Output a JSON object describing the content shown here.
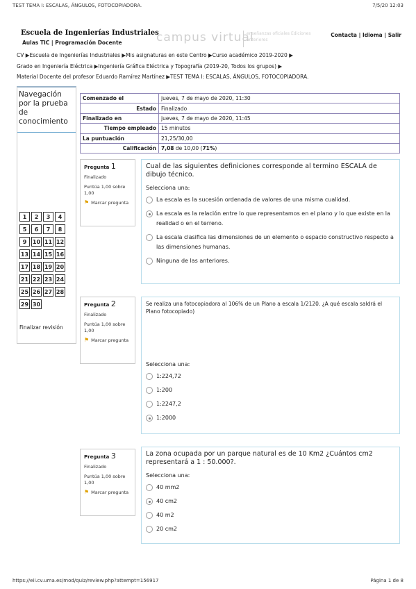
{
  "print": {
    "header_left": "TEST TEMA I: ESCALAS, ÁNGULOS, FOTOCOPIADORA.",
    "header_right": "7/5/20 12:03",
    "footer_left": "https://eii.cv.uma.es/mod/quiz/review.php?attempt=156917",
    "footer_right": "Página 1 de 8"
  },
  "banner": {
    "school": "Escuela de Ingenierías Industriales",
    "subnav_aulas": "Aulas TIC",
    "subnav_sep": " | ",
    "subnav_prog": "Programación Docente",
    "campus": "campus virtual",
    "campus_sub": "enseñanzas oficiales  Ediciones anteriores",
    "contacta": "Contacta",
    "idioma": "Idioma",
    "salir": "Salir",
    "sep": " | "
  },
  "breadcrumb": {
    "line1": "CV ▶Escuela de Ingenierías Industriales ▶Mis asignaturas en este Centro ▶Curso académico 2019-2020 ▶",
    "line2": "Grado en Ingeniería Eléctrica ▶Ingeniería Gráfica Eléctrica y Topografía (2019-20, Todos los grupos) ▶",
    "line3": "Material Docente del profesor Eduardo Ramírez Martínez ▶TEST TEMA I: ESCALAS, ÁNGULOS, FOTOCOPIADORA."
  },
  "nav": {
    "title": "Navegación por la prueba de conocimiento",
    "rows": [
      [
        "1",
        "2",
        "3",
        "4"
      ],
      [
        "5",
        "6",
        "7",
        "8"
      ],
      [
        "9",
        "10",
        "11",
        "12"
      ],
      [
        "13",
        "14",
        "15",
        "16"
      ],
      [
        "17",
        "18",
        "19",
        "20"
      ],
      [
        "21",
        "22",
        "23",
        "24"
      ],
      [
        "25",
        "26",
        "27",
        "28"
      ],
      [
        "29",
        "30"
      ]
    ],
    "finish": "Finalizar revisión"
  },
  "summary": {
    "started_label": "Comenzado el",
    "started_value": "jueves, 7 de mayo de 2020, 11:30",
    "state_label": "Estado",
    "state_value": "Finalizado",
    "finished_label": "Finalizado en",
    "finished_value": "jueves, 7 de mayo de 2020, 11:45",
    "time_label": "Tiempo empleado",
    "time_value": "15 minutos",
    "score_label": "La puntuación",
    "score_value": "21,25/30,00",
    "grade_label": "Calificación",
    "grade_value_bold": "7,08",
    "grade_value_mid": " de 10,00 (",
    "grade_value_pct": "71%",
    "grade_value_end": ")"
  },
  "questions": [
    {
      "label": "Pregunta",
      "number": "1",
      "state": "Finalizado",
      "points": "Puntúa 1,00 sobre 1,00",
      "flag": "Marcar pregunta",
      "text": "Cual de las siguientes definiciones corresponde al termino ESCALA de dibujo técnico.",
      "select_label": "Selecciona una:",
      "options": [
        "La escala es la sucesión ordenada de valores de una misma cualidad.",
        "La escala es la relación entre lo que representamos en el plano y lo que existe en la realidad o en el terreno.",
        "La escala clasifica las dimensiones de un elemento o espacio constructivo respecto a las dimensiones humanas.",
        "Ninguna de las anteriores."
      ],
      "selected": 1
    },
    {
      "label": "Pregunta",
      "number": "2",
      "state": "Finalizado",
      "points": "Puntúa 1,00 sobre 1,00",
      "flag": "Marcar pregunta",
      "text": "Se realiza una fotocopiadora al 106% de un Plano a escala 1/2120. ¿A qué escala saldrá el Plano fotocopiado)",
      "select_label": "Selecciona una:",
      "options": [
        "1:224,72",
        "1:200",
        "1:2247,2",
        "1:2000"
      ],
      "selected": 3
    },
    {
      "label": "Pregunta",
      "number": "3",
      "state": "Finalizado",
      "points": "Puntúa 1,00 sobre 1,00",
      "flag": "Marcar pregunta",
      "text": "La zona ocupada por un parque natural es de 10 Km2 ¿Cuántos cm2 representará a 1 : 50.000?.",
      "select_label": "Selecciona una:",
      "options": [
        "40 mm2",
        "40 cm2",
        "40 m2",
        "20 cm2"
      ],
      "selected": 1
    }
  ]
}
